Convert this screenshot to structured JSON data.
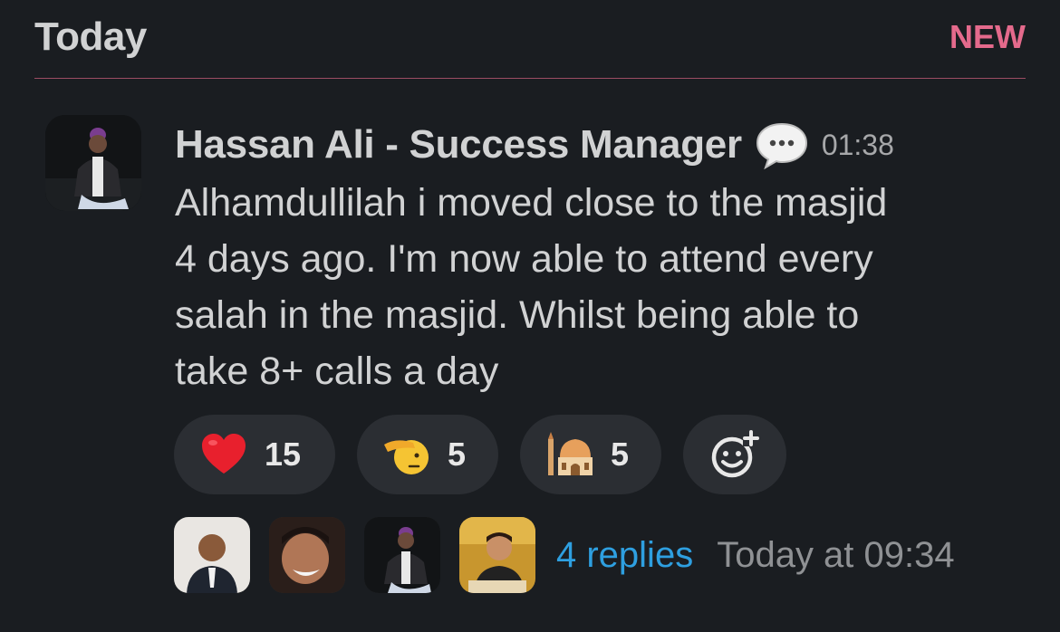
{
  "header": {
    "day_label": "Today",
    "new_label": "NEW"
  },
  "message": {
    "sender": "Hassan Ali - Success Manager",
    "status_icon": "speech-bubble-icon",
    "time": "01:38",
    "lines": [
      "Alhamdullilah i moved close to the masjid",
      "4 days ago. I'm now able to attend every",
      "salah in the masjid. Whilst being able to",
      "take 8+ calls a day"
    ]
  },
  "reactions": [
    {
      "icon": "heart-icon",
      "count": "15"
    },
    {
      "icon": "saluting-face-icon",
      "count": "5"
    },
    {
      "icon": "mosque-icon",
      "count": "5"
    }
  ],
  "add_reaction_icon": "add-reaction-icon",
  "thread": {
    "replies_label": "4 replies",
    "last_reply": "Today at 09:34"
  },
  "colors": {
    "background": "#1a1d21",
    "new_divider": "#e46a8c",
    "link": "#2e9fe0",
    "pill": "#2b2e33"
  }
}
